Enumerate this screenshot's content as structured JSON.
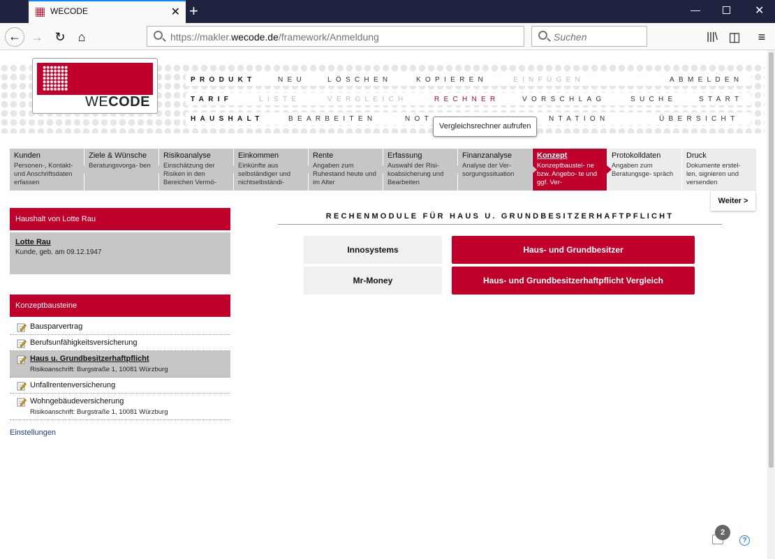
{
  "browser": {
    "tab_title": "WECODE",
    "url_prefix": "https://makler.",
    "url_domain": "wecode.de",
    "url_path": "/framework/Anmeldung",
    "search_placeholder": "Suchen"
  },
  "logo": {
    "text_light": "WE",
    "text_bold": "CODE"
  },
  "menu": {
    "row1": [
      {
        "label": "PRODUKT",
        "state": "bold"
      },
      {
        "label": "NEU",
        "state": "normal"
      },
      {
        "label": "LÖSCHEN",
        "state": "normal"
      },
      {
        "label": "KOPIEREN",
        "state": "normal"
      },
      {
        "label": "EINFÜGEN",
        "state": "disabled"
      },
      {
        "label": "ABMELDEN",
        "state": "normal"
      }
    ],
    "row2": [
      {
        "label": "TARIF",
        "state": "bold"
      },
      {
        "label": "LISTE",
        "state": "disabled"
      },
      {
        "label": "VERGLEICH",
        "state": "disabled"
      },
      {
        "label": "RECHNER",
        "state": "active"
      },
      {
        "label": "VORSCHLAG",
        "state": "normal"
      },
      {
        "label": "SUCHE",
        "state": "normal"
      },
      {
        "label": "START",
        "state": "normal"
      }
    ],
    "row3": [
      {
        "label": "HAUSHALT",
        "state": "bold"
      },
      {
        "label": "BEARBEITEN",
        "state": "normal"
      },
      {
        "label": "NOT",
        "state": "normal"
      },
      {
        "label": "NTATION",
        "state": "normal"
      },
      {
        "label": "ÜBERSICHT",
        "state": "normal"
      }
    ],
    "tooltip": "Vergleichsrechner aufrufen"
  },
  "steps": [
    {
      "title": "Kunden",
      "desc": "Personen-, Kontakt- und Anschriftsdaten erfassen"
    },
    {
      "title": "Ziele & Wünsche",
      "desc": "Beratungsvorga- ben"
    },
    {
      "title": "Risikoanalyse",
      "desc": "Einschätzung der Risiken in den Bereichen Vermö-"
    },
    {
      "title": "Einkommen",
      "desc": "Einkünfte aus selbständiger und nichtselbständi-"
    },
    {
      "title": "Rente",
      "desc": "Angaben zum Ruhestand heute und im Alter"
    },
    {
      "title": "Erfassung",
      "desc": "Auswahl der Risi- koabsicherung und Bearbeiten"
    },
    {
      "title": "Finanzanalyse",
      "desc": "Analyse der Ver- sorgungssituation"
    },
    {
      "title": "Konzept",
      "desc": "Konzeptbaustei- ne bzw. Angebo- te und ggf. Ver-"
    },
    {
      "title": "Protokolldaten",
      "desc": "Angaben zum Beratungsge- spräch"
    },
    {
      "title": "Druck",
      "desc": "Dokumente erstel- len, signieren und versenden"
    }
  ],
  "weiter": "Weiter >",
  "household": {
    "header": "Haushalt von Lotte Rau",
    "name": "Lotte Rau",
    "info": "Kunde, geb. am 09.12.1947"
  },
  "konzept": {
    "header": "Konzeptbausteine",
    "items": [
      {
        "title": "Bausparvertrag",
        "sub": ""
      },
      {
        "title": "Berufsunfähigkeitsversicherung",
        "sub": ""
      },
      {
        "title": "Haus u. Grundbesitzerhaftpflicht",
        "sub": "Risikoanschrift: Burgstraße 1, 10081 Würzburg"
      },
      {
        "title": "Unfallrentenversicherung",
        "sub": ""
      },
      {
        "title": "Wohngebäudeversicherung",
        "sub": "Risikoanschrift: Burgstraße 1, 10081 Würzburg"
      }
    ],
    "settings": "Einstellungen"
  },
  "main": {
    "title": "RECHENMODULE FÜR HAUS U. GRUNDBESITZERHAFTPFLICHT",
    "providers": [
      "Innosystems",
      "Mr-Money"
    ],
    "modules": [
      "Haus- und Grundbesitzer",
      "Haus- und Grundbesitzerhaftpflicht Vergleich"
    ]
  },
  "footer": {
    "chat_count": "2",
    "help": "?"
  }
}
